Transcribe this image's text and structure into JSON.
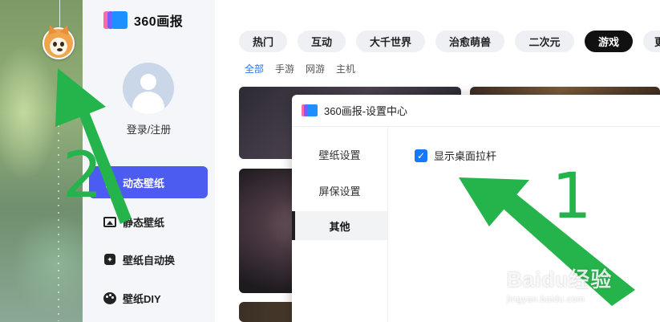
{
  "app": {
    "brand": "360画报",
    "login_text": "登录/注册"
  },
  "sidebar": {
    "items": [
      {
        "label": "动态壁纸",
        "active": true
      },
      {
        "label": "静态壁纸"
      },
      {
        "label": "壁纸自动换"
      },
      {
        "label": "壁纸DIY"
      }
    ]
  },
  "main": {
    "chips": [
      "热门",
      "互动",
      "大千世界",
      "治愈萌兽",
      "二次元",
      "游戏",
      "更"
    ],
    "active_chip": "游戏",
    "sub_tabs": [
      "全部",
      "手游",
      "网游",
      "主机"
    ],
    "active_sub_tab": "全部"
  },
  "dialog": {
    "title": "360画报-设置中心",
    "tabs": [
      "壁纸设置",
      "屏保设置",
      "其他"
    ],
    "active_tab": "其他",
    "checkbox": {
      "label": "显示桌面拉杆",
      "checked": true,
      "mark": "✓"
    }
  },
  "annotations": {
    "step1": "1",
    "step2": "2",
    "color": "#25b34b"
  },
  "watermark": {
    "text": "Baidu经验",
    "url": "jingyan.baidu.com"
  },
  "colors": {
    "accent": "#4d5cf0",
    "checkbox": "#1677ff",
    "active_chip": "#111111",
    "sidebar_bg": "#f4f6f9"
  }
}
